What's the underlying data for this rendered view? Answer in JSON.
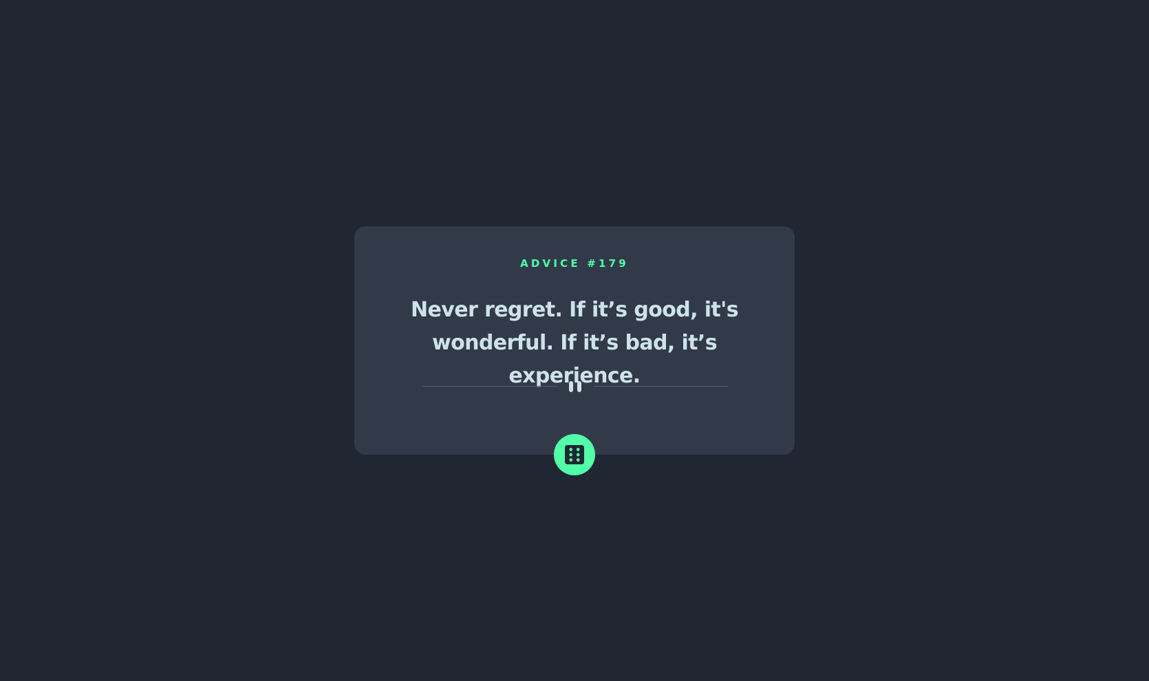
{
  "advice": {
    "label": "ADVICE #179",
    "quote": "Never regret. If it’s good, it's wonderful. If it’s bad, it’s experience."
  },
  "colors": {
    "background": "#202632",
    "card": "#323a4a",
    "accent": "#52ffa8",
    "text": "#cee3e9",
    "divider": "#4f5d74"
  },
  "icons": {
    "divider": "pause-icon",
    "button": "dice-icon"
  }
}
